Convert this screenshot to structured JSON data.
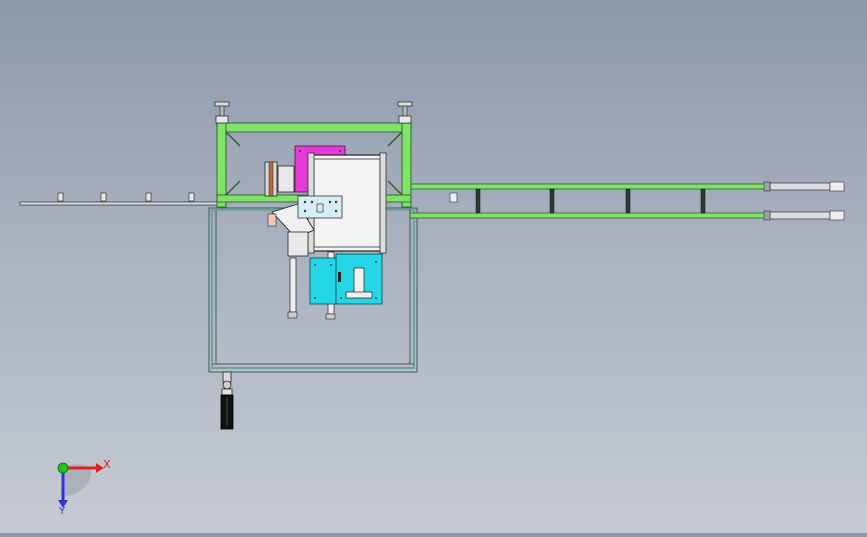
{
  "viewport": {
    "background_top": "#8d98aa",
    "background_bottom": "#c6cbd3"
  },
  "model": {
    "frame_color": "#7fe36a",
    "frame_stroke": "#2f5f2a",
    "support_color": "#5e8f86",
    "panel_magenta": "#e63ad6",
    "panel_cyan": "#27d6e6",
    "panel_white": "#f4f4f4",
    "panel_lightblue": "#d7ecf3"
  },
  "triad": {
    "x_label": "X",
    "y_label": "Y",
    "x_color": "#e02020",
    "y_color": "#2b35d8",
    "z_color": "#1fc21f"
  }
}
